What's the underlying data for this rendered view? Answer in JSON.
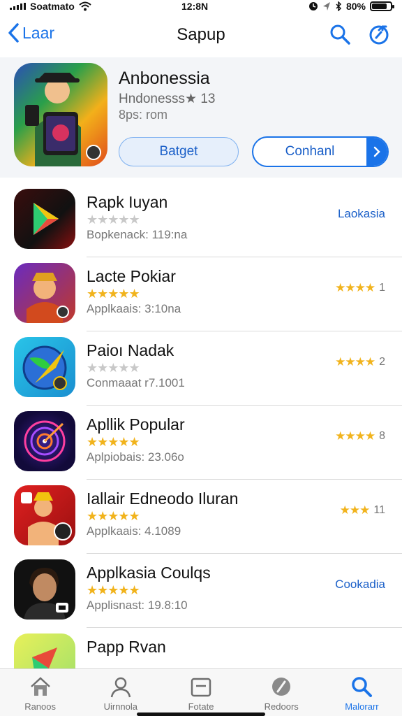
{
  "status": {
    "carrier": "Soatmato",
    "time": "12:8N",
    "battery": "80%"
  },
  "nav": {
    "back_label": "Laar",
    "title": "Sapup"
  },
  "featured": {
    "name": "Anbonessia",
    "subtitle": "Hndonesss★ 13",
    "size": "8ps: rom",
    "get_label": "Batget",
    "action_label": "Conhanl"
  },
  "apps": [
    {
      "name": "Rapk Iuyan",
      "stars": "★★★★★",
      "stars_gray": true,
      "meta": "Bopkenack: 119:na",
      "right_text": "Laokasia"
    },
    {
      "name": "Lacte Pokiar",
      "stars": "★★★★★",
      "stars_gray": false,
      "meta": "Applkaais: 3:10na",
      "right_stars": "★★★★",
      "right_num": "1"
    },
    {
      "name": "Paioı Nadak",
      "stars": "★★★★★",
      "stars_gray": true,
      "meta": "Conmaaat r7.1001",
      "right_stars": "★★★★",
      "right_num": "2"
    },
    {
      "name": "Apllik Popular",
      "stars": "★★★★★",
      "stars_gray": false,
      "meta": "Aplpiobais: 23.06o",
      "right_stars": "★★★★",
      "right_num": "8"
    },
    {
      "name": "Iallair Edneodo Iluran",
      "stars": "★★★★★",
      "stars_gray": false,
      "meta": "Applkaais: 4.1089",
      "right_stars": "★★★",
      "right_num": "11"
    },
    {
      "name": "Applkasia Coulqs",
      "stars": "★★★★★",
      "stars_gray": false,
      "meta": "Applisnast: 19.8:10",
      "right_text": "Cookadia"
    },
    {
      "name": "Papp Rvan",
      "stars": "",
      "stars_gray": false,
      "meta": "",
      "right_text": ""
    }
  ],
  "tabs": [
    {
      "label": "Ranoos"
    },
    {
      "label": "Uirnnola"
    },
    {
      "label": "Fotate"
    },
    {
      "label": "Redoors"
    },
    {
      "label": "Malorarr"
    }
  ],
  "colors": {
    "accent": "#1a73e8",
    "star": "#f1b31c"
  }
}
